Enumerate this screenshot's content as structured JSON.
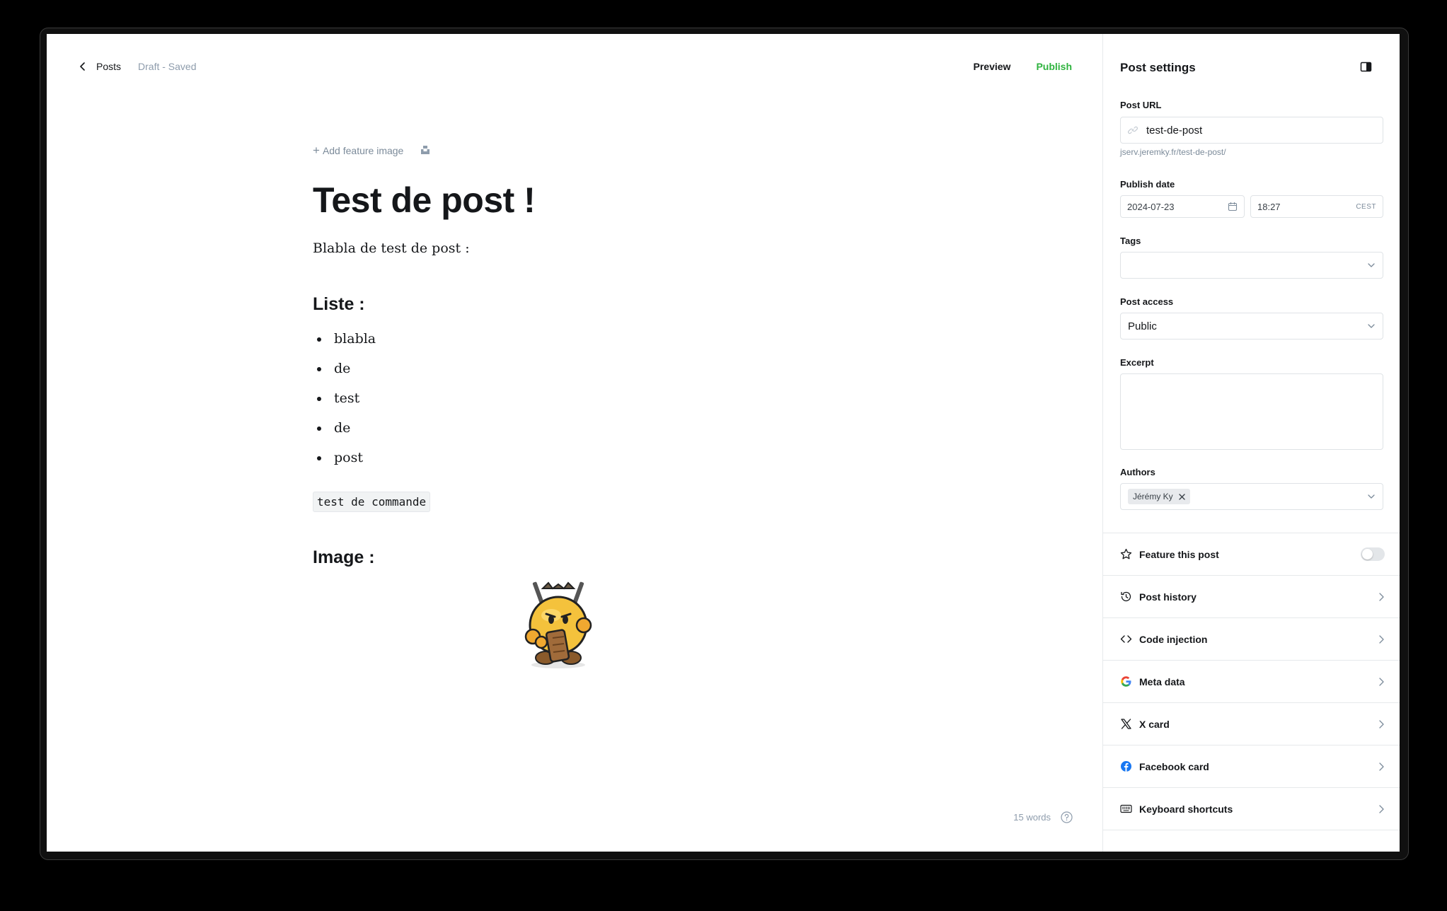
{
  "editor": {
    "back_label": "Posts",
    "status": "Draft - Saved",
    "preview_label": "Preview",
    "publish_label": "Publish",
    "add_feature_image": "Add feature image",
    "title": "Test de post !",
    "paragraph": "Blabla de test de post :",
    "heading_list": "Liste :",
    "list_items": [
      "blabla",
      "de",
      "test",
      "de",
      "post"
    ],
    "code_text": "test de commande",
    "heading_image": "Image :",
    "word_count": "15 words"
  },
  "sidebar": {
    "title": "Post settings",
    "post_url_label": "Post URL",
    "post_url_value": "test-de-post",
    "post_url_hint": "jserv.jeremky.fr/test-de-post/",
    "publish_date_label": "Publish date",
    "publish_date": "2024-07-23",
    "publish_time": "18:27",
    "timezone": "CEST",
    "tags_label": "Tags",
    "tags_value": "",
    "access_label": "Post access",
    "access_value": "Public",
    "excerpt_label": "Excerpt",
    "excerpt_value": "",
    "authors_label": "Authors",
    "author_chip": "Jérémy Ky",
    "rows": [
      {
        "label": "Feature this post",
        "icon": "star-icon"
      },
      {
        "label": "Post history",
        "icon": "history-icon"
      },
      {
        "label": "Code injection",
        "icon": "code-icon"
      },
      {
        "label": "Meta data",
        "icon": "google-icon"
      },
      {
        "label": "X card",
        "icon": "x-icon"
      },
      {
        "label": "Facebook card",
        "icon": "facebook-icon"
      },
      {
        "label": "Keyboard shortcuts",
        "icon": "keyboard-icon"
      }
    ]
  },
  "colors": {
    "accent_green": "#2fb33f",
    "text_dark": "#15171a",
    "text_muted": "#8e9cac",
    "border": "#dfe3e6"
  }
}
